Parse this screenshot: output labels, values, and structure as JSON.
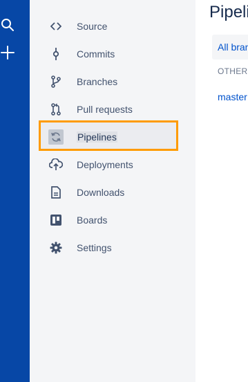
{
  "global_nav": {
    "icons": [
      "search-icon",
      "plus-icon"
    ],
    "colors": {
      "background": "#0747a6",
      "icon": "#ffffff"
    }
  },
  "sidebar": {
    "items": [
      {
        "label": "Source",
        "icon": "code-icon"
      },
      {
        "label": "Commits",
        "icon": "commit-icon"
      },
      {
        "label": "Branches",
        "icon": "branch-icon"
      },
      {
        "label": "Pull requests",
        "icon": "pull-request-icon"
      },
      {
        "label": "Pipelines",
        "icon": "refresh-icon",
        "selected": true
      },
      {
        "label": "Deployments",
        "icon": "cloud-upload-icon"
      },
      {
        "label": "Downloads",
        "icon": "document-icon"
      },
      {
        "label": "Boards",
        "icon": "board-icon"
      },
      {
        "label": "Settings",
        "icon": "gear-icon"
      }
    ],
    "colors": {
      "background": "#f4f5f7",
      "text": "#42526e",
      "highlight_border": "#ff9b00"
    }
  },
  "main": {
    "title": "Pipeli",
    "branch_filter": "All bran",
    "group_label": "OTHER",
    "branch": "master"
  }
}
